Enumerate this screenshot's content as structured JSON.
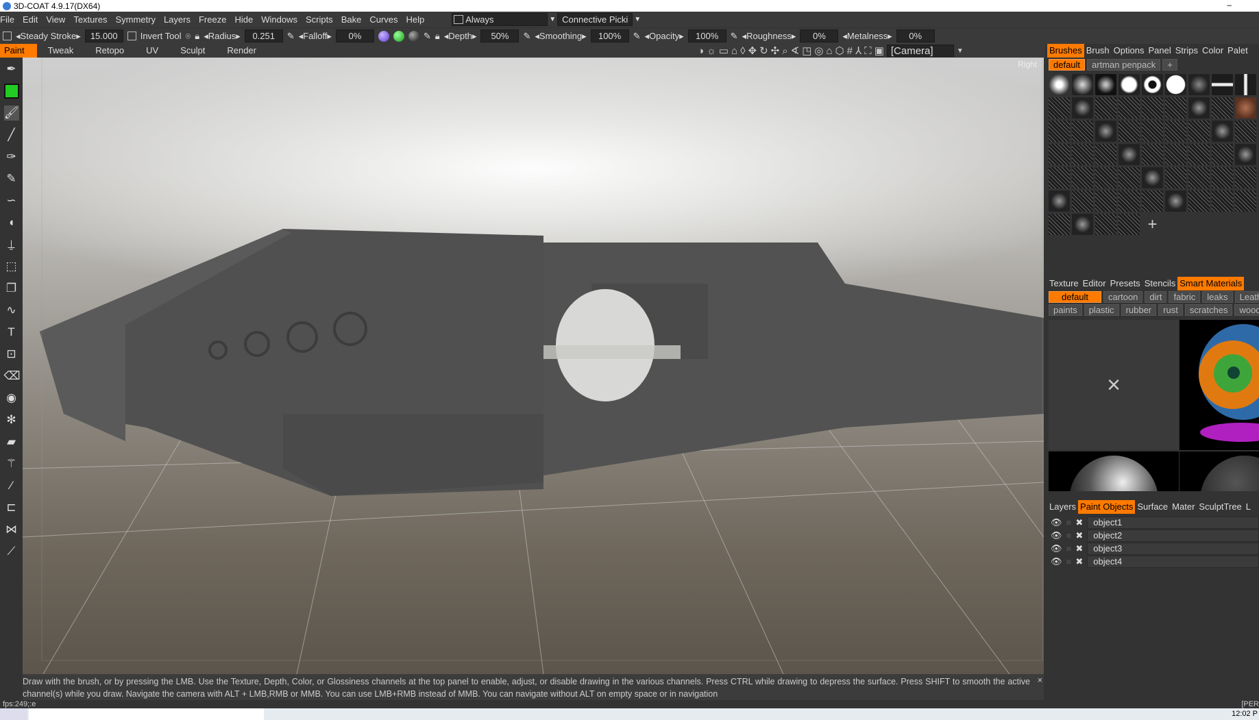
{
  "window": {
    "title": "3D-COAT 4.9.17(DX64)",
    "minimize": "–"
  },
  "menu": [
    "File",
    "Edit",
    "View",
    "Textures",
    "Symmetry",
    "Layers",
    "Freeze",
    "Hide",
    "Windows",
    "Scripts",
    "Bake",
    "Curves",
    "Help"
  ],
  "menu_extra": {
    "always": "Always",
    "connective": "Connective Picki"
  },
  "toolbar": {
    "steady_stroke": "Steady Stroke",
    "steady_value": "15.000",
    "invert_tool": "Invert Tool",
    "radius": "Radius",
    "radius_value": "0.251",
    "falloff": "Falloff",
    "falloff_value": "0%",
    "depth": "Depth",
    "depth_value": "50%",
    "smoothing": "Smoothing",
    "smoothing_value": "100%",
    "opacity": "Opacity",
    "opacity_value": "100%",
    "roughness": "Roughness",
    "roughness_value": "0%",
    "metalness": "Metalness",
    "metalness_value": "0%"
  },
  "modes": [
    "Paint",
    "Tweak",
    "Retopo",
    "UV",
    "Sculpt",
    "Render"
  ],
  "camera": "[Camera]",
  "view_label": "Right",
  "right_panel": {
    "brush_tabs": [
      "Brushes",
      "Brush",
      "Options",
      "Panel",
      "Strips",
      "Color",
      "Palet"
    ],
    "brush_sets": [
      "default",
      "artman penpack",
      "+"
    ],
    "material_tabs": [
      "Texture",
      "Editor",
      "Presets",
      "Stencils",
      "Smart Materials"
    ],
    "material_row1": [
      "default",
      "cartoon",
      "dirt",
      "fabric",
      "leaks",
      "Leathe"
    ],
    "material_row2": [
      "paints",
      "plastic",
      "rubber",
      "rust",
      "scratches",
      "wood",
      "+"
    ],
    "empty_slot": "×",
    "layer_tabs": [
      "Layers",
      "Paint Objects",
      "Surface",
      "Mater",
      "SculptTree",
      "L"
    ],
    "objects": [
      "object1",
      "object2",
      "object3",
      "object4"
    ]
  },
  "help_text": "Draw with the brush, or by pressing the LMB. Use the Texture, Depth, Color, or Glossiness channels at the top panel to enable, adjust, or disable drawing in the various channels. Press CTRL while drawing to depress the surface. Press SHIFT to smooth the active channel(s) while you draw. Navigate the camera with ALT + LMB,RMB or MMB. You can use LMB+RMB instead of MMB. You can navigate without ALT on empty space or in navigation",
  "help_close": "×",
  "status": {
    "fps": "fps:249;:e",
    "right": "[PER"
  },
  "taskbar": {
    "clock": "12:02 P"
  },
  "colors": {
    "accent": "#ff7a00",
    "primary_color": "#22cc22"
  }
}
